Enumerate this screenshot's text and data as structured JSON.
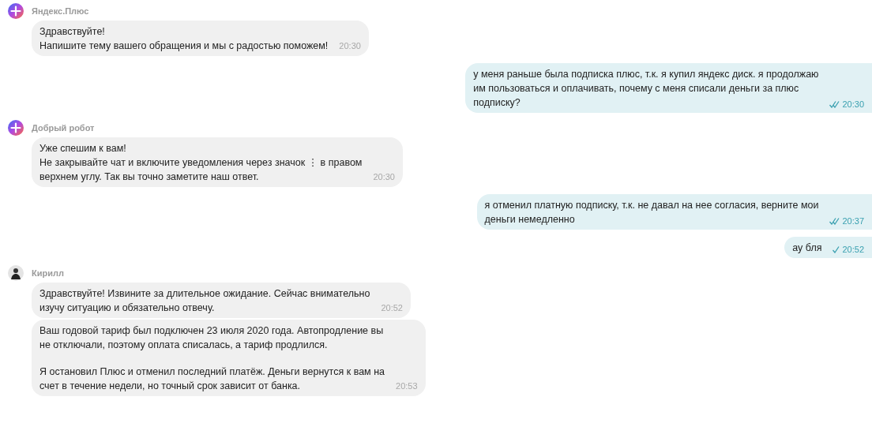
{
  "messages": [
    {
      "kind": "incoming",
      "sender": "Яндекс.Плюс",
      "avatar": {
        "kind": "logo"
      },
      "bubbles": [
        {
          "paragraphs": [
            [
              "Здравствуйте!",
              "Напишите тему вашего обращения и мы с радостью поможем!"
            ]
          ],
          "time": "20:30"
        }
      ]
    },
    {
      "kind": "outgoing",
      "lines": [
        "у меня раньше была подписка плюс, т.к. я купил яндекс диск. я продолжаю",
        "им пользоваться и оплачивать, почему с меня списали деньги за плюс",
        "подписку?"
      ],
      "time": "20:30",
      "read": true
    },
    {
      "kind": "incoming",
      "sender": "Добрый робот",
      "avatar": {
        "kind": "logo"
      },
      "bubbles": [
        {
          "paragraphs": [
            [
              "Уже спешим к вам!",
              "Не закрывайте чат и включите уведомления через значок ⋮ в правом",
              "верхнем углу. Так вы точно заметите наш ответ."
            ]
          ],
          "time": "20:30"
        }
      ]
    },
    {
      "kind": "outgoing",
      "lines": [
        "я отменил платную подписку, т.к. не давал на нее согласия, верните мои",
        "деньги немедленно"
      ],
      "time": "20:37",
      "read": true
    },
    {
      "kind": "outgoing",
      "lines": [
        "ау бля"
      ],
      "time": "20:52",
      "read": false
    },
    {
      "kind": "incoming",
      "sender": "Кирилл",
      "avatar": {
        "kind": "person"
      },
      "bubbles": [
        {
          "paragraphs": [
            [
              "Здравствуйте! Извините за длительное ожидание. Сейчас внимательно",
              "изучу ситуацию и обязательно отвечу."
            ]
          ],
          "time": "20:52"
        },
        {
          "paragraphs": [
            [
              "Ваш годовой тариф был подключен 23 июля 2020 года. Автопродление вы",
              "не отключали, поэтому оплата списалась, а тариф продлился."
            ],
            [
              "Я остановил Плюс и отменил последний платёж. Деньги вернутся к вам на",
              "счет в течение недели, но точный срок зависит от банка."
            ]
          ],
          "time": "20:53"
        }
      ]
    }
  ]
}
